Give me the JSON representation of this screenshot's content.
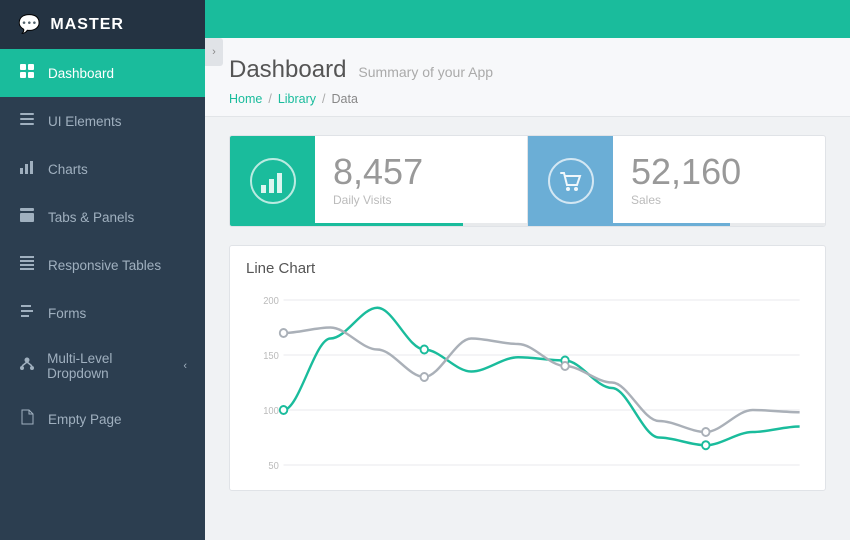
{
  "sidebar": {
    "logo": {
      "icon": "💬",
      "text": "MASTER"
    },
    "items": [
      {
        "id": "dashboard",
        "icon": "⊞",
        "label": "Dashboard",
        "active": true,
        "arrow": false
      },
      {
        "id": "ui-elements",
        "icon": "🖥",
        "label": "UI Elements",
        "active": false,
        "arrow": false
      },
      {
        "id": "charts",
        "icon": "📊",
        "label": "Charts",
        "active": false,
        "arrow": false
      },
      {
        "id": "tabs-panels",
        "icon": "≡",
        "label": "Tabs & Panels",
        "active": false,
        "arrow": false
      },
      {
        "id": "responsive-tables",
        "icon": "⊟",
        "label": "Responsive Tables",
        "active": false,
        "arrow": false
      },
      {
        "id": "forms",
        "icon": "✏",
        "label": "Forms",
        "active": false,
        "arrow": false
      },
      {
        "id": "multi-level",
        "icon": "👥",
        "label": "Multi-Level Dropdown",
        "active": false,
        "arrow": true
      },
      {
        "id": "empty-page",
        "icon": "📄",
        "label": "Empty Page",
        "active": false,
        "arrow": false
      }
    ]
  },
  "page": {
    "title": "Dashboard",
    "subtitle": "Summary of your App",
    "breadcrumb": [
      "Home",
      "Library",
      "Data"
    ]
  },
  "stats": [
    {
      "id": "daily-visits",
      "icon": "📊",
      "color": "green",
      "number": "8,457",
      "label": "Daily Visits",
      "progress": 70
    },
    {
      "id": "sales",
      "icon": "🛒",
      "color": "blue",
      "number": "52,160",
      "label": "Sales",
      "progress": 55
    }
  ],
  "chart": {
    "title": "Line Chart",
    "yLabels": [
      "200",
      "150",
      "100",
      "50"
    ],
    "series": {
      "teal": [
        100,
        165,
        193,
        155,
        135,
        148,
        145,
        120,
        75,
        68,
        80,
        85
      ],
      "gray": [
        170,
        175,
        155,
        130,
        165,
        160,
        140,
        125,
        90,
        80,
        100,
        98
      ]
    }
  },
  "toggle_icon": "›"
}
